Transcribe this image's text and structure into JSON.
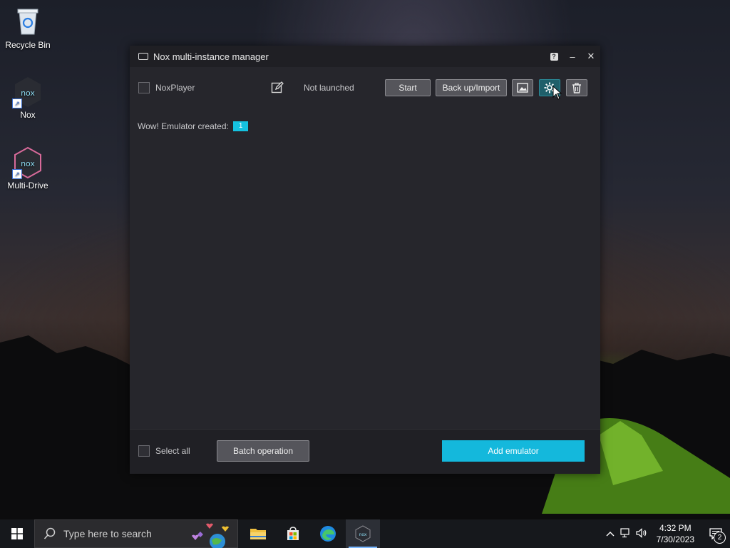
{
  "desktop": {
    "icons": [
      {
        "label": "Recycle Bin",
        "icon": "recycle-bin-icon"
      },
      {
        "label": "Nox",
        "icon": "nox-icon"
      },
      {
        "label": "Multi-Drive",
        "icon": "multi-drive-icon"
      }
    ]
  },
  "window": {
    "title": "Nox multi-instance manager",
    "controls": {
      "help": "?",
      "minimize": "–",
      "close": "✕"
    },
    "instance": {
      "name": "NoxPlayer",
      "status": "Not launched",
      "start_label": "Start",
      "backup_label": "Back up/Import"
    },
    "created_text": "Wow! Emulator created:",
    "created_count": "1",
    "footer": {
      "select_all": "Select all",
      "batch_label": "Batch operation",
      "add_label": "Add emulator"
    },
    "colors": {
      "accent": "#14b8dc",
      "active_icon_button": "#1f5f6a"
    }
  },
  "taskbar": {
    "search_placeholder": "Type here to search",
    "clock_time": "4:32 PM",
    "clock_date": "7/30/2023",
    "notification_count": "2"
  }
}
